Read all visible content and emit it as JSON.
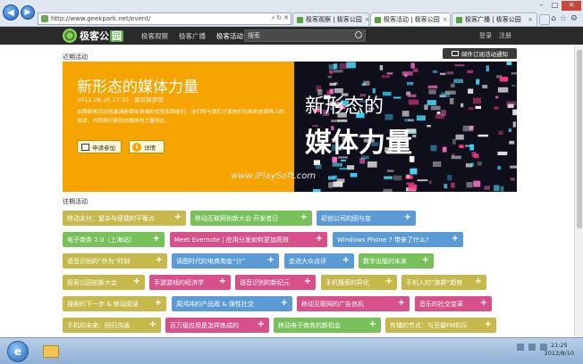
{
  "browser": {
    "url": "http://www.geekpark.net/event/",
    "tabs": [
      {
        "label": "极客观察 | 极客公园",
        "close": "×"
      },
      {
        "label": "极客活动 | 极客公园",
        "close": "×"
      },
      {
        "label": "极客广播 | 极客公园",
        "close": "×"
      }
    ],
    "window": {
      "min": "–",
      "max": "□",
      "close": "✕"
    },
    "nav": {
      "back": "◀",
      "forward": "▶"
    },
    "tools": {
      "home": "⌂",
      "favorites": "☆",
      "settings": "⚙"
    }
  },
  "header": {
    "logo": "极客公",
    "logo_badge": "园",
    "nav": [
      "极客观察",
      "极客广播",
      "极客活动"
    ],
    "search_placeholder": "搜索",
    "login": "登录",
    "register": "注册"
  },
  "recent": {
    "section_title": "近期活动",
    "subscribe": "邮件订阅活动通知",
    "title": "新形态的媒体力量",
    "date": "2012.08.16 17:35 · 索尼探梦馆",
    "description": "本期极客活动将邀请新媒体领域的优秀实践者们，他们将与我们分享他们在新形态媒体上的尝试，共同探讨新形态媒体的力量所在。",
    "apply": "申请参加",
    "detail": "详情",
    "hero_line1": "新形态的",
    "hero_line2": "媒体力量",
    "watermark": "www.iPlaySoft.com"
  },
  "past": {
    "section_title": "往期活动",
    "tags": [
      {
        "label": "移动支付：复杂与便捷的平衡点",
        "color": "#c5b94c"
      },
      {
        "label": "移动互联网创新大会·开发者日",
        "color": "#77c05a"
      },
      {
        "label": "初创公司的困与变",
        "color": "#5b9bd5"
      },
      {
        "label": "电子商务 2.0（上海站）",
        "color": "#77c05a"
      },
      {
        "label": "Meet Evernote | 应用分发如何更加高效",
        "color": "#d8508a"
      },
      {
        "label": "Windows Phone 7 带来了什么?",
        "color": "#5b9bd5"
      },
      {
        "label": "语音识别的“作为”时刻",
        "color": "#c5b94c"
      },
      {
        "label": "读图时代的电商淘金“计”",
        "color": "#5b9bd5"
      },
      {
        "label": "走进大众点评",
        "color": "#5b9bd5"
      },
      {
        "label": "数字出版的未来",
        "color": "#77c05a"
      },
      {
        "label": "极客公园创新大会",
        "color": "#c5b94c"
      },
      {
        "label": "手游游戏的经济学",
        "color": "#d8508a"
      },
      {
        "label": "语音识别的新纪元",
        "color": "#d8508a"
      },
      {
        "label": "手机搜索的异化",
        "color": "#c5b94c"
      },
      {
        "label": "手机入的“族群”趋势",
        "color": "#c5b94c"
      },
      {
        "label": "搜索的下一步 & 移动阅读",
        "color": "#c5b94c"
      },
      {
        "label": "周鸿祎的产品观 & 弹性社交",
        "color": "#5b9bd5"
      },
      {
        "label": "移动互联网的广告良机",
        "color": "#d8508a"
      },
      {
        "label": "音乐的社交变革",
        "color": "#d8508a"
      },
      {
        "label": "手机的未来：回归沟通",
        "color": "#c5b94c"
      },
      {
        "label": "百万级应用是怎样炼成的",
        "color": "#d8508a"
      },
      {
        "label": "移动电子商务的新机会",
        "color": "#77c05a"
      },
      {
        "label": "传播的节点：与豆瓣FM的乐",
        "color": "#c5b94c"
      }
    ]
  },
  "taskbar": {
    "start": "e",
    "time": "21:25",
    "date": "2012/8/10"
  },
  "colors": {
    "banner_orange": "#f5a400",
    "header_dark": "#2a2a2a",
    "brand_green": "#5fb04a"
  }
}
